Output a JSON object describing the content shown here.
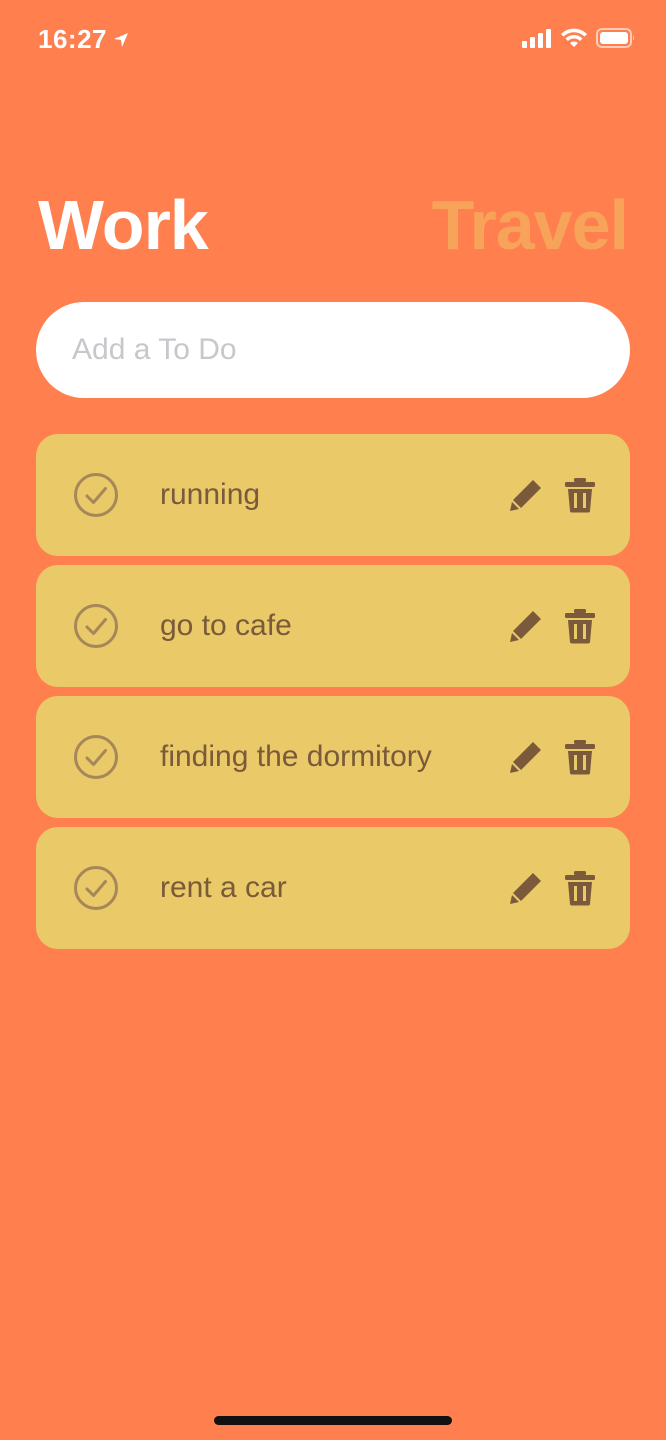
{
  "status_bar": {
    "time": "16:27",
    "icons": [
      "location-arrow-icon",
      "signal-icon",
      "wifi-icon",
      "battery-icon"
    ]
  },
  "tabs": {
    "work_label": "Work",
    "travel_label": "Travel",
    "active": "Work"
  },
  "input": {
    "placeholder": "Add a To Do",
    "value": ""
  },
  "todos": [
    {
      "text": "running",
      "icons": [
        "check-circle-icon",
        "pencil-icon",
        "trash-icon"
      ]
    },
    {
      "text": "go to cafe",
      "icons": [
        "check-circle-icon",
        "pencil-icon",
        "trash-icon"
      ]
    },
    {
      "text": "finding the dormitory",
      "icons": [
        "check-circle-icon",
        "pencil-icon",
        "trash-icon"
      ]
    },
    {
      "text": "rent a car",
      "icons": [
        "check-circle-icon",
        "pencil-icon",
        "trash-icon"
      ]
    }
  ],
  "colors": {
    "background": "#FF7F4F",
    "card": "#E9C968",
    "card_text": "#7A5A3A",
    "tab_active": "#FFFFFF",
    "tab_inactive": "#F8A35A",
    "input_bg": "#FFFFFF"
  }
}
